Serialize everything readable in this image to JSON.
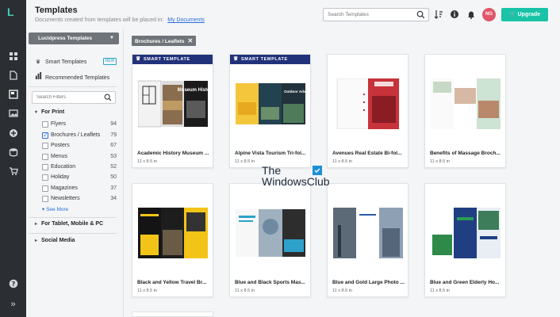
{
  "header": {
    "title": "Templates",
    "subtitle": "Documents created from templates will be placed in:",
    "subtitle_link": "My Documents",
    "search_placeholder": "Search Templates",
    "avatar_initials": "NG",
    "upgrade_label": "Upgrade"
  },
  "rail": {
    "icons": [
      "logo-icon",
      "grid-icon",
      "document-icon",
      "templates-icon",
      "image-icon",
      "plus-circle-icon",
      "database-icon",
      "cart-icon",
      "help-icon",
      "expand-icon"
    ]
  },
  "sidebar": {
    "dropdown_label": "Lucidpress Templates",
    "smart_templates": "Smart Templates",
    "new_badge": "NEW",
    "recommended": "Recommended Templates",
    "filter_placeholder": "Search Filters",
    "for_print": "For Print",
    "print_filters": [
      {
        "label": "Flyers",
        "count": "94",
        "checked": false
      },
      {
        "label": "Brochures / Leaflets",
        "count": "79",
        "checked": true
      },
      {
        "label": "Posters",
        "count": "67",
        "checked": false
      },
      {
        "label": "Menus",
        "count": "53",
        "checked": false
      },
      {
        "label": "Education",
        "count": "52",
        "checked": false
      },
      {
        "label": "Holiday",
        "count": "50",
        "checked": false
      },
      {
        "label": "Magazines",
        "count": "37",
        "checked": false
      },
      {
        "label": "Newsletters",
        "count": "34",
        "checked": false
      }
    ],
    "see_more": "See More",
    "for_tablet": "For Tablet, Mobile & PC",
    "social_media": "Social Media"
  },
  "main": {
    "active_filter_chip": "Brochures / Leaflets",
    "smart_template_banner": "SMART TEMPLATE",
    "cards": [
      {
        "name": "Academic History Museum ...",
        "size": "11 x 8.5 in",
        "smart": true
      },
      {
        "name": "Alpine Vista Tourism Tri-fol...",
        "size": "11 x 8.5 in",
        "smart": true
      },
      {
        "name": "Avenues Real Estate Bi-fol...",
        "size": "11 x 8.5 in",
        "smart": false
      },
      {
        "name": "Benefits of Massage Broch...",
        "size": "11 x 8.5 in",
        "smart": false
      },
      {
        "name": "Black and Yellow Travel Br...",
        "size": "11 x 8.5 in",
        "smart": false
      },
      {
        "name": "Blue and Black Sports Mas...",
        "size": "11 x 8.5 in",
        "smart": false
      },
      {
        "name": "Blue and Gold Large Photo ...",
        "size": "11 x 8.5 in",
        "smart": false
      },
      {
        "name": "Blue and Green Elderly Ho...",
        "size": "11 x 8.5 in",
        "smart": false
      }
    ],
    "thumb_text": {
      "museum": "Museum History",
      "outdoor": "Outdoor Adventure"
    }
  },
  "watermark": {
    "line1": "The",
    "line2": "WindowsClub"
  },
  "colors": {
    "rail": "#2b2f33",
    "accent": "#18c3a7",
    "banner": "#22327a",
    "link": "#2b6cd9"
  }
}
